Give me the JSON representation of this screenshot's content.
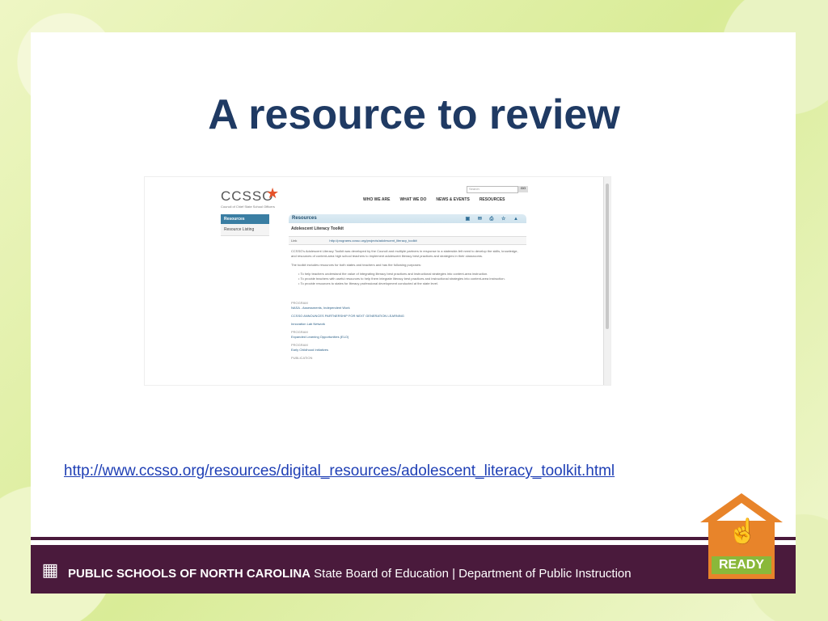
{
  "slide": {
    "title": "A resource to review",
    "link": "http://www.ccsso.org/resources/digital_resources/adolescent_literacy_toolkit.html"
  },
  "screenshot": {
    "logo": "CCSSO",
    "logo_tagline": "Council of Chief State School Officers",
    "search_placeholder": "Search",
    "go_label": "GO",
    "nav": [
      "WHO WE ARE",
      "WHAT WE DO",
      "NEWS & EVENTS",
      "RESOURCES"
    ],
    "sidebar": {
      "active": "Resources",
      "items": [
        "Resource Listing"
      ]
    },
    "main": {
      "header": "Resources",
      "page_title": "Adolescent Literacy Toolkit",
      "url_label": "Link",
      "url_value": "http://programs.ccsso.org/projects/adolescent_literacy_toolkit",
      "intro": "CCSSO's Adolescent Literacy Toolkit was developed by the Council and multiple partners in response to a statewide-felt need to develop the skills, knowledge, and resources of content-area high school teachers to implement adolescent literacy best practices and strategies in their classrooms.",
      "purpose_intro": "The toolkit includes resources for both states and teachers and has the following purposes:",
      "bullets": [
        "To help teachers understand the value of integrating literacy best practices and instructional strategies into content-area instruction.",
        "To provide teachers with useful resources to help them integrate literacy best practices and instructional strategies into content-area instruction.",
        "To provide resources to states for literacy professional development conducted at the state level."
      ],
      "meta": [
        {
          "label": "PROGRAM",
          "link": "NASA - Assessments, Independent Work"
        },
        {
          "label": "",
          "link": "CCSSO ANNOUNCES PARTNERSHIP FOR NEXT GENERATION LEARNING"
        },
        {
          "label": "",
          "link": "Innovation Lab Network"
        },
        {
          "label": "PROGRAM",
          "link": "Expanded Learning Opportunities (ELO)"
        },
        {
          "label": "PROGRAM",
          "link": "Early Childhood Initiatives"
        },
        {
          "label": "PUBLICATION",
          "link": ""
        }
      ]
    }
  },
  "footer": {
    "brand_bold": "PUBLIC SCHOOLS OF NORTH CAROLINA",
    "brand_rest": "State Board of Education | Department of Public Instruction"
  },
  "badge": {
    "word": "READY"
  },
  "colors": {
    "title": "#1f3a63",
    "footer": "#4a1a3c",
    "ready_orange": "#e8842a",
    "ready_green": "#8ab83a"
  }
}
